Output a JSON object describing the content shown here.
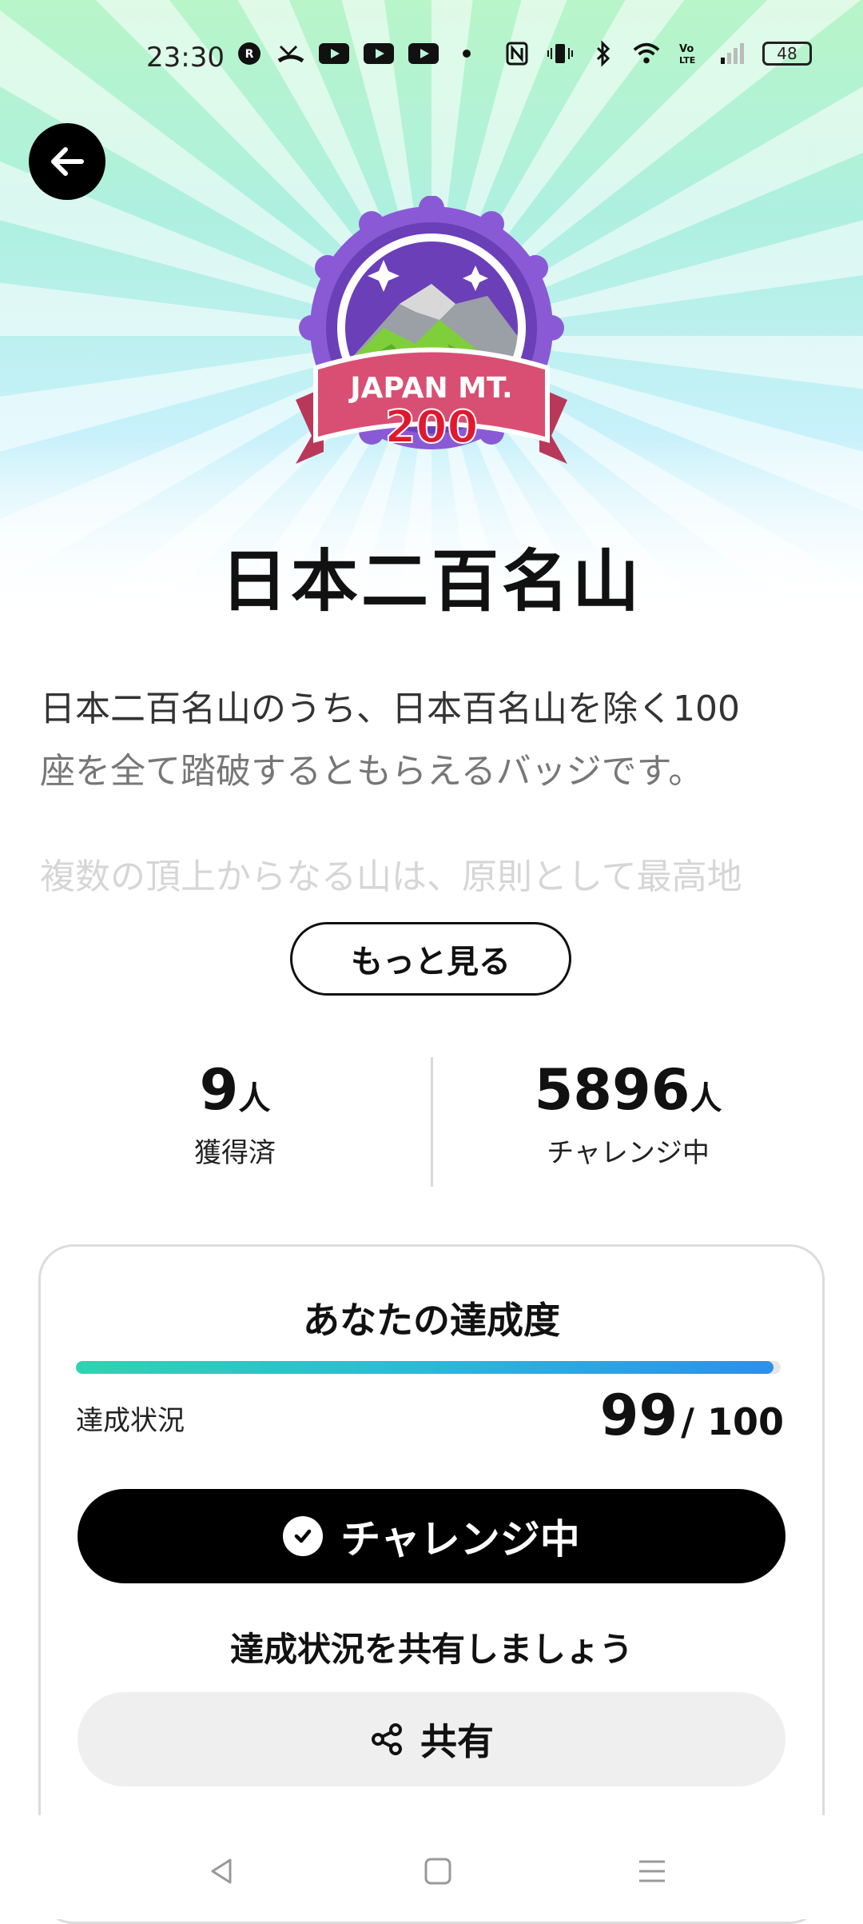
{
  "status_bar": {
    "time": "23:30",
    "battery": "48",
    "icons": [
      "rakuten-link-icon",
      "missed-call-icon",
      "youtube-icon",
      "youtube-icon",
      "youtube-icon",
      "dot-icon",
      "nfc-icon",
      "vibrate-icon",
      "bluetooth-icon",
      "wifi-icon",
      "volte-icon",
      "signal-icon",
      "battery-icon"
    ]
  },
  "header": {
    "back_icon": "arrow-left-icon"
  },
  "badge": {
    "line1": "JAPAN MT.",
    "line2": "200"
  },
  "title": "日本二百名山",
  "description": {
    "line1": "日本二百名山のうち、日本百名山を除く100",
    "line2": "座を全て踏破するともらえるバッジです。",
    "line3": "複数の頂上からなる山は、原則として最高地"
  },
  "more_button": "もっと見る",
  "stats": {
    "acquired": {
      "count": "9",
      "unit": "人",
      "label": "獲得済"
    },
    "challenging": {
      "count": "5896",
      "unit": "人",
      "label": "チャレンジ中"
    }
  },
  "progress_card": {
    "title": "あなたの達成度",
    "progress_fraction": 0.99,
    "status_label": "達成状況",
    "current": "99",
    "total": "/ 100",
    "challenge_button": "チャレンジ中",
    "share_prompt": "達成状況を共有しましょう",
    "share_button": "共有"
  },
  "colors": {
    "progress_start": "#2fd3b0",
    "progress_end": "#2e8fe8",
    "badge_purple": "#7b4fc4",
    "badge_ribbon": "#d94f73"
  }
}
